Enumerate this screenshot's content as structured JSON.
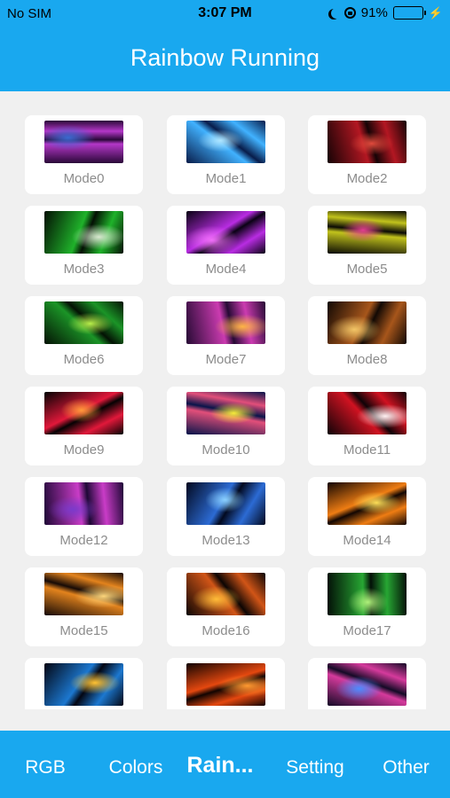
{
  "status": {
    "carrier": "No SIM",
    "time": "3:07 PM",
    "battery": "91%",
    "battery_level": 0.91
  },
  "header": {
    "title": "Rainbow Running"
  },
  "modes": [
    {
      "label": "Mode0",
      "colors": [
        "#2a0838",
        "#b437c8",
        "#3a6ad0"
      ]
    },
    {
      "label": "Mode1",
      "colors": [
        "#081c4a",
        "#41b2ff",
        "#b0e6ff"
      ]
    },
    {
      "label": "Mode2",
      "colors": [
        "#150305",
        "#b31722",
        "#e24a3c"
      ]
    },
    {
      "label": "Mode3",
      "colors": [
        "#041004",
        "#1fb22a",
        "#d9e8d0"
      ]
    },
    {
      "label": "Mode4",
      "colors": [
        "#0a0214",
        "#b82ce2",
        "#f170f9"
      ]
    },
    {
      "label": "Mode5",
      "colors": [
        "#0a0a04",
        "#c2c31c",
        "#e23f8f"
      ]
    },
    {
      "label": "Mode6",
      "colors": [
        "#041204",
        "#1b9427",
        "#b8f04b"
      ]
    },
    {
      "label": "Mode7",
      "colors": [
        "#260a34",
        "#cb3bb0",
        "#ffb545"
      ]
    },
    {
      "label": "Mode8",
      "colors": [
        "#120904",
        "#a7561b",
        "#f2c566"
      ]
    },
    {
      "label": "Mode9",
      "colors": [
        "#050203",
        "#e1183a",
        "#ff9a3a"
      ]
    },
    {
      "label": "Mode10",
      "colors": [
        "#08144a",
        "#e24f7a",
        "#f7ec3a"
      ]
    },
    {
      "label": "Mode11",
      "colors": [
        "#0f0307",
        "#d01221",
        "#fff1f2"
      ]
    },
    {
      "label": "Mode12",
      "colors": [
        "#1e0836",
        "#c93cc7",
        "#7b3acb"
      ]
    },
    {
      "label": "Mode13",
      "colors": [
        "#02091f",
        "#2c6bd4",
        "#8bd1ff"
      ]
    },
    {
      "label": "Mode14",
      "colors": [
        "#120602",
        "#ef7d13",
        "#ffdf58"
      ]
    },
    {
      "label": "Mode15",
      "colors": [
        "#160a06",
        "#e3831d",
        "#ffd77c"
      ]
    },
    {
      "label": "Mode16",
      "colors": [
        "#0c0503",
        "#d15517",
        "#ffbc39"
      ]
    },
    {
      "label": "Mode17",
      "colors": [
        "#031007",
        "#27a633",
        "#aef17a"
      ]
    },
    {
      "label": "",
      "colors": [
        "#030612",
        "#1c78d0",
        "#ffc233"
      ]
    },
    {
      "label": "",
      "colors": [
        "#110401",
        "#e5480f",
        "#ff9a31"
      ]
    },
    {
      "label": "",
      "colors": [
        "#140a26",
        "#d53a9c",
        "#4b8cff"
      ]
    }
  ],
  "tabs": [
    {
      "label": "RGB",
      "active": false
    },
    {
      "label": "Colors",
      "active": false
    },
    {
      "label": "Rain...",
      "active": true
    },
    {
      "label": "Setting",
      "active": false
    },
    {
      "label": "Other",
      "active": false
    }
  ]
}
